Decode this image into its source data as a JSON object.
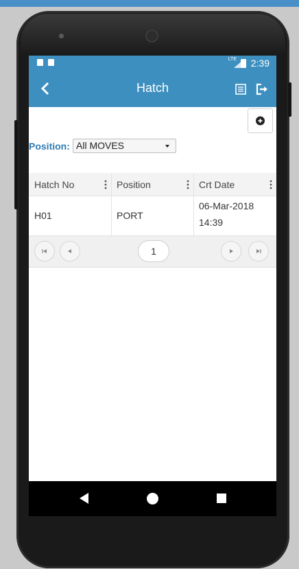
{
  "status_bar": {
    "network": "LTE",
    "time": "2:39"
  },
  "app_bar": {
    "title": "Hatch",
    "back_icon": "arrow-back-icon",
    "list_icon": "list-view-icon",
    "logout_icon": "logout-icon"
  },
  "toolbar": {
    "add_icon": "plus-circle-icon"
  },
  "filter": {
    "label": "Position:",
    "selected": "All MOVES"
  },
  "grid": {
    "columns": [
      "Hatch No",
      "Position",
      "Crt Date"
    ],
    "rows": [
      {
        "hatch_no": "H01",
        "position": "PORT",
        "crt_date_line1": "06-Mar-2018",
        "crt_date_line2": "14:39"
      }
    ]
  },
  "pager": {
    "current_page": "1",
    "first_icon": "first-page-icon",
    "prev_icon": "prev-page-icon",
    "next_icon": "next-page-icon",
    "last_icon": "last-page-icon"
  },
  "nav_bar": {
    "back_icon": "nav-back-icon",
    "home_icon": "nav-home-icon",
    "recents_icon": "nav-recents-icon"
  },
  "colors": {
    "app_bar": "#3d8fc0",
    "accent_label": "#2e7db5",
    "nav_bar": "#000000"
  }
}
